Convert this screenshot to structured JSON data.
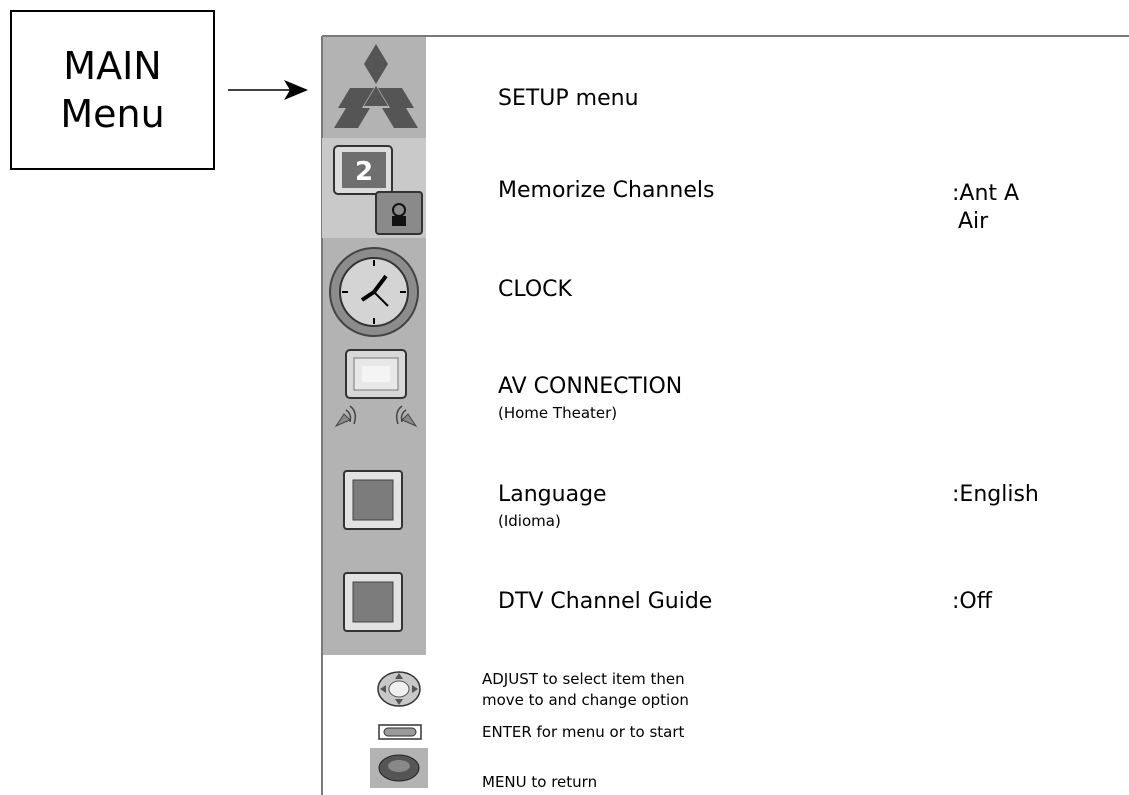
{
  "callout": {
    "line1": "MAIN",
    "line2": "Menu"
  },
  "menu_items": [
    {
      "icon": "mitsubishi-logo-icon",
      "label": "SETUP menu",
      "sublabel": "",
      "value": ""
    },
    {
      "icon": "memorize-channels-icon",
      "label": "Memorize Channels",
      "sublabel": "",
      "value_line1": ":Ant A",
      "value_line2": " Air"
    },
    {
      "icon": "clock-icon",
      "label": "CLOCK",
      "sublabel": "",
      "value": ""
    },
    {
      "icon": "av-connection-icon",
      "label": "AV CONNECTION",
      "sublabel": "(Home Theater)",
      "value": ""
    },
    {
      "icon": "language-icon",
      "label": "Language",
      "sublabel": "(Idioma)",
      "value": ":English"
    },
    {
      "icon": "dtv-guide-icon",
      "label": "DTV Channel Guide",
      "sublabel": "",
      "value": ":Off"
    }
  ],
  "help": [
    {
      "icon": "adjust-pad-icon",
      "line1": "ADJUST to select item then",
      "line2": "move to and change option"
    },
    {
      "icon": "enter-button-icon",
      "line1": "ENTER for menu or to start"
    },
    {
      "icon": "menu-button-icon",
      "line1": "MENU to return"
    }
  ],
  "colors": {
    "sidebar": "#b3b3b3",
    "frame": "#7a7a7a",
    "icon_red": "#7c7c7c"
  }
}
